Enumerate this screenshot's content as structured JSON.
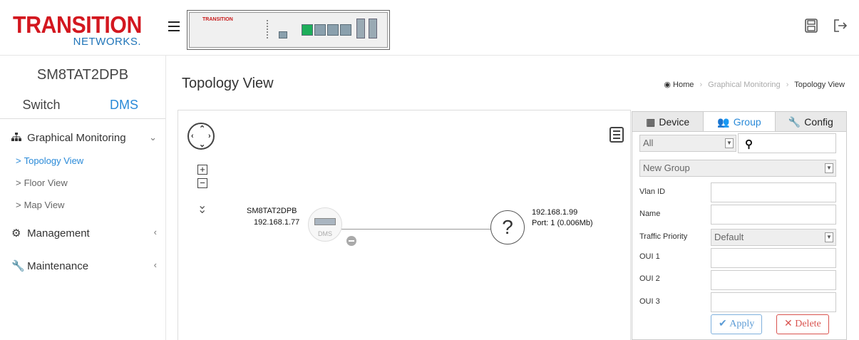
{
  "brand": {
    "name": "TRANSITION",
    "sub": "NETWORKS.",
    "panel_brand": "TRANSITION"
  },
  "header": {
    "icons": [
      "save-icon",
      "logout-icon"
    ]
  },
  "sidebar": {
    "model": "SM8TAT2DPB",
    "tabs": [
      {
        "label": "Switch"
      },
      {
        "label": "DMS"
      }
    ],
    "groups": [
      {
        "label": "Graphical Monitoring",
        "icon": "sitemap-icon",
        "items": [
          {
            "label": "Topology View"
          },
          {
            "label": "Floor View"
          },
          {
            "label": "Map View"
          }
        ]
      },
      {
        "label": "Management",
        "icon": "gear-icon"
      },
      {
        "label": "Maintenance",
        "icon": "wrench-icon"
      }
    ]
  },
  "main": {
    "title": "Topology View",
    "breadcrumb": {
      "home": "Home",
      "section": "Graphical Monitoring",
      "current": "Topology View"
    }
  },
  "topology": {
    "switch_node": {
      "name": "SM8TAT2DPB",
      "ip": "192.168.1.77",
      "badge": "DMS"
    },
    "unknown_node": {
      "symbol": "?",
      "ip": "192.168.1.99",
      "port_info": "Port: 1 (0.006Mb)"
    }
  },
  "panel": {
    "tabs": [
      {
        "label": "Device",
        "icon": "grid-icon"
      },
      {
        "label": "Group",
        "icon": "users-icon"
      },
      {
        "label": "Config",
        "icon": "wrench-icon"
      }
    ],
    "filter_value": "All",
    "group_select": "New Group",
    "labels": {
      "vlan": "Vlan ID",
      "name": "Name",
      "priority": "Traffic Priority",
      "oui1": "OUI 1",
      "oui2": "OUI 2",
      "oui3": "OUI 3"
    },
    "priority_value": "Default",
    "apply_label": "Apply",
    "delete_label": "Delete"
  },
  "colors": {
    "accent": "#2a8ad8",
    "brand_red": "#d3171f",
    "brand_blue": "#1f74b8",
    "delete": "#d9534f",
    "port_up": "#1eae5a"
  }
}
